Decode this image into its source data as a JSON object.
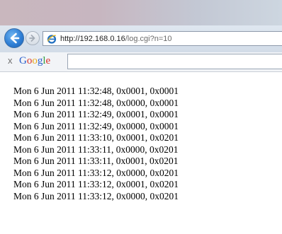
{
  "browser": {
    "address_host": "http://192.168.0.16",
    "address_path": "/log.cgi?n=10",
    "address_value": "http://192.168.0.16/log.cgi?n=10"
  },
  "google_toolbar": {
    "close_label": "x",
    "logo_letters": [
      "G",
      "o",
      "o",
      "g",
      "l",
      "e"
    ],
    "logo_colors": [
      "#2b5fcc",
      "#d8342a",
      "#e8a91c",
      "#2b5fcc",
      "#2f9a3e",
      "#d8342a"
    ],
    "search_value": ""
  },
  "log": {
    "lines": [
      "Mon 6 Jun 2011 11:32:48, 0x0001, 0x0001",
      "Mon 6 Jun 2011 11:32:48, 0x0000, 0x0001",
      "Mon 6 Jun 2011 11:32:49, 0x0001, 0x0001",
      "Mon 6 Jun 2011 11:32:49, 0x0000, 0x0001",
      "Mon 6 Jun 2011 11:33:10, 0x0001, 0x0201",
      "Mon 6 Jun 2011 11:33:11, 0x0000, 0x0201",
      "Mon 6 Jun 2011 11:33:11, 0x0001, 0x0201",
      "Mon 6 Jun 2011 11:33:12, 0x0000, 0x0201",
      "Mon 6 Jun 2011 11:33:12, 0x0001, 0x0201",
      "Mon 6 Jun 2011 11:33:12, 0x0000, 0x0201"
    ]
  },
  "colors": {
    "back_button": "#2f7fd6",
    "nav_bar": "#d8e1ec",
    "ie_icon": "#1f6fc1"
  },
  "icons": {
    "back": "back-arrow-icon",
    "forward": "forward-arrow-icon",
    "page": "internet-explorer-icon",
    "close": "close-icon"
  }
}
